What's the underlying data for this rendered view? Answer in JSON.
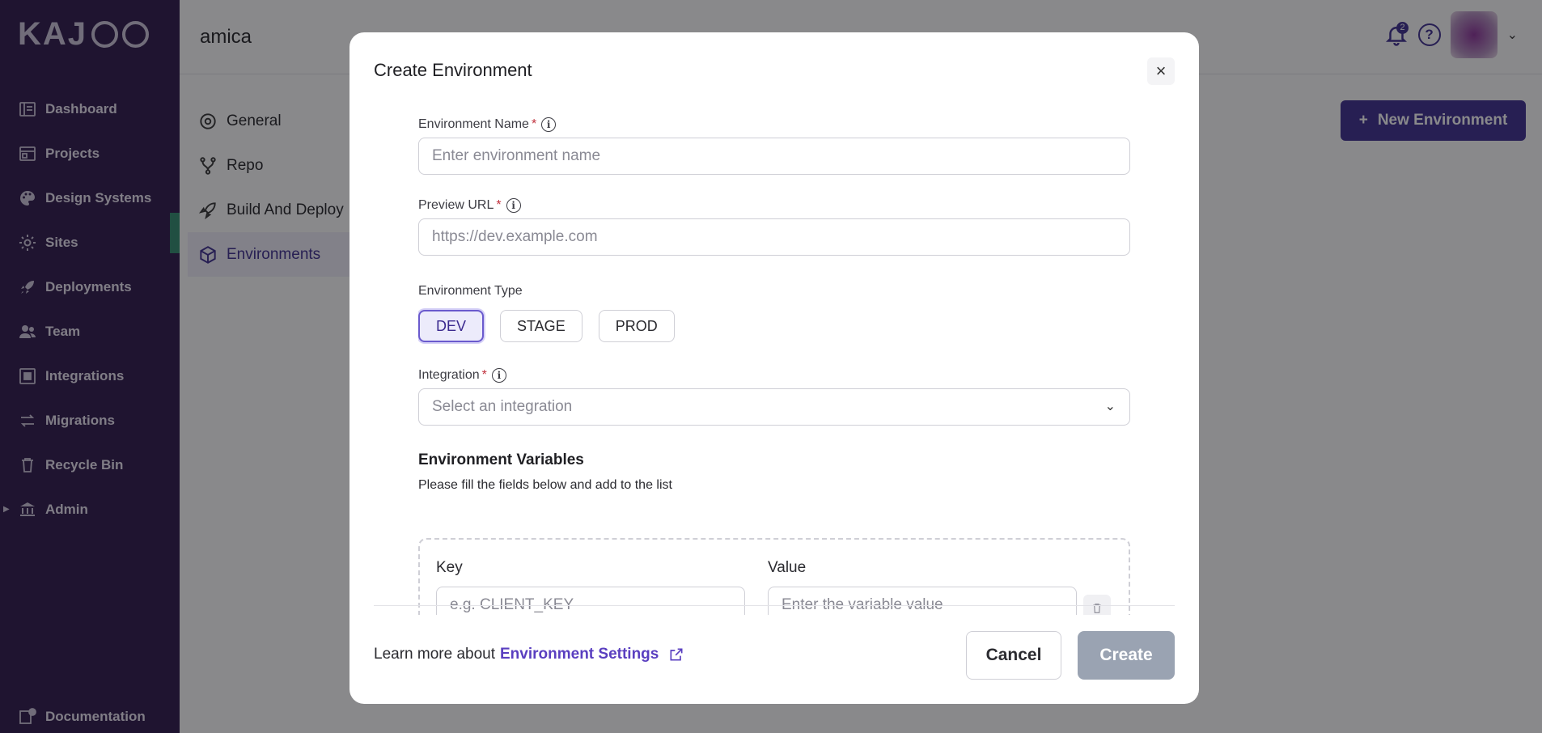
{
  "sidebar": {
    "logo_text": "KAJOO",
    "items": [
      {
        "label": "Dashboard",
        "icon": "dashboard-icon"
      },
      {
        "label": "Projects",
        "icon": "projects-icon"
      },
      {
        "label": "Design Systems",
        "icon": "palette-icon"
      },
      {
        "label": "Sites",
        "icon": "gear-icon"
      },
      {
        "label": "Deployments",
        "icon": "rocket-icon"
      },
      {
        "label": "Team",
        "icon": "team-icon"
      },
      {
        "label": "Integrations",
        "icon": "integrations-icon"
      },
      {
        "label": "Migrations",
        "icon": "arrows-icon"
      },
      {
        "label": "Recycle Bin",
        "icon": "trash-icon"
      },
      {
        "label": "Admin",
        "icon": "bank-icon"
      }
    ],
    "documentation_label": "Documentation"
  },
  "topbar": {
    "project_name": "amica",
    "notification_count": "2",
    "help_glyph": "?"
  },
  "settings_nav": {
    "items": [
      {
        "label": "General",
        "icon": "gear-icon"
      },
      {
        "label": "Repo",
        "icon": "branch-icon"
      },
      {
        "label": "Build And Deploy",
        "icon": "rocket-icon"
      },
      {
        "label": "Environments",
        "icon": "cube-icon",
        "active": true
      }
    ]
  },
  "new_environment_button": "New Environment",
  "modal": {
    "title": "Create Environment",
    "close_glyph": "×",
    "env_name": {
      "label": "Environment Name",
      "required": "*",
      "placeholder": "Enter environment name"
    },
    "preview_url": {
      "label": "Preview URL",
      "required": "*",
      "placeholder": "https://dev.example.com"
    },
    "env_type": {
      "label": "Environment Type",
      "options": [
        "DEV",
        "STAGE",
        "PROD"
      ],
      "selected": "DEV"
    },
    "integration": {
      "label": "Integration",
      "required": "*",
      "placeholder": "Select an integration"
    },
    "env_vars": {
      "title": "Environment Variables",
      "subtitle": "Please fill the fields below and add to the list",
      "key_label": "Key",
      "key_placeholder": "e.g. CLIENT_KEY",
      "value_label": "Value",
      "value_placeholder": "Enter the variable value"
    },
    "footer": {
      "learn_more": "Learn more about",
      "link_text": "Environment Settings",
      "cancel": "Cancel",
      "create": "Create"
    }
  },
  "colors": {
    "sidebar_bg": "#2a1448",
    "primary": "#3b2a8f",
    "link": "#5a3fc0",
    "create_disabled": "#9aa3b2",
    "active_bar": "#2e8a6d"
  }
}
